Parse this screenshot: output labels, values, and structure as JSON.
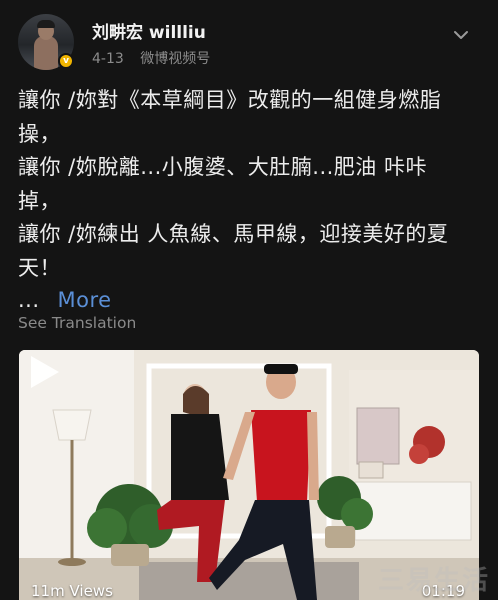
{
  "post": {
    "author": "刘畊宏 willliu",
    "date": "4-13",
    "source": "微博视频号",
    "text_lines": [
      "讓你 /妳對《本草綱目》改觀的一組健身燃脂",
      "操，",
      "讓你 /妳脫離...小腹婆、大肚腩...肥油 咔咔",
      "掉，",
      "讓你 /妳練出 人魚線、馬甲線，迎接美好的夏",
      "天！"
    ],
    "ellipsis": "...",
    "more_label": "More",
    "translate_label": "See Translation"
  },
  "video": {
    "views": "11m Views",
    "duration": "01:19"
  },
  "watermark": "三易生活",
  "colors": {
    "background": "#141414",
    "link": "#5b8fd6",
    "verified": "#f0b400"
  },
  "icons": {
    "verified": "verified-badge-icon",
    "menu": "chevron-down-icon",
    "play": "play-icon"
  }
}
